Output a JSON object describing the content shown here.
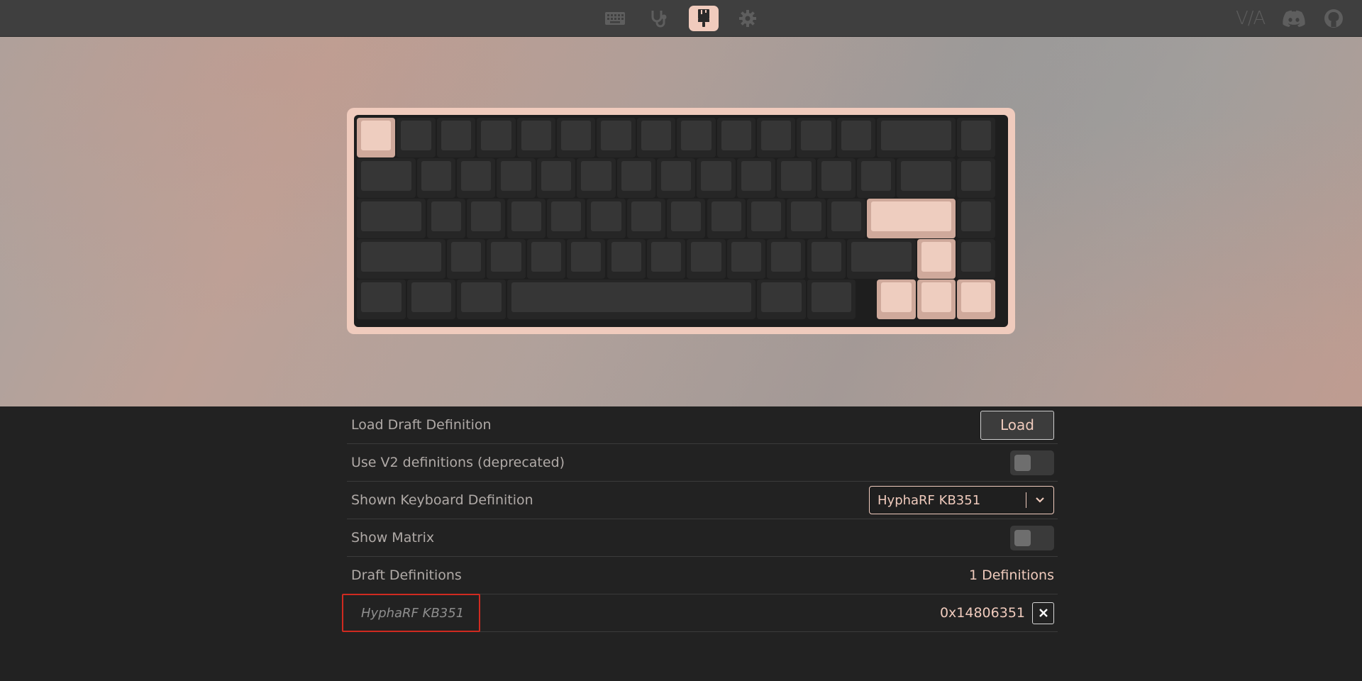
{
  "topbar": {
    "nav": [
      {
        "icon": "keyboard-icon",
        "label": "Configure",
        "active": false
      },
      {
        "icon": "stethoscope-icon",
        "label": "Key Tester",
        "active": false
      },
      {
        "icon": "paintbrush-icon",
        "label": "Design",
        "active": true
      },
      {
        "icon": "gear-icon",
        "label": "Settings",
        "active": false
      }
    ],
    "logo_text": "V/A",
    "links": [
      {
        "icon": "discord-icon"
      },
      {
        "icon": "github-icon"
      }
    ]
  },
  "keyboard": {
    "accent_color": "#f0cbbd",
    "key_color": "#363636",
    "highlighted_keys": [
      "Esc",
      "Enter",
      "Up",
      "Left",
      "Down",
      "Right"
    ]
  },
  "settings": {
    "load_draft": {
      "label": "Load Draft Definition",
      "button": "Load"
    },
    "use_v2": {
      "label": "Use V2 definitions (deprecated)",
      "enabled": false
    },
    "shown_definition": {
      "label": "Shown Keyboard Definition",
      "value": "HyphaRF KB351"
    },
    "show_matrix": {
      "label": "Show Matrix",
      "enabled": false
    },
    "draft_definitions": {
      "label": "Draft Definitions",
      "count": "1 Definitions"
    },
    "definitions": [
      {
        "name": "HyphaRF KB351",
        "id": "0x14806351"
      }
    ]
  }
}
